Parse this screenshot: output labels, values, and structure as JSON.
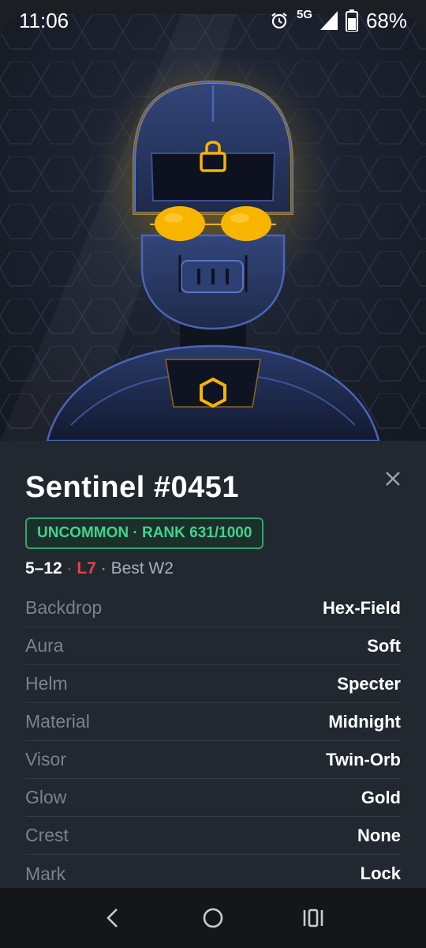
{
  "status": {
    "time": "11:06",
    "network": "5G",
    "battery": "68%"
  },
  "nft": {
    "title": "Sentinel #0451",
    "badge": "UNCOMMON · RANK 631/1000",
    "record": {
      "wins_losses": "5–12",
      "separator": " · ",
      "loss_streak": "L7",
      "best": "Best W2"
    },
    "traits": [
      {
        "label": "Backdrop",
        "value": "Hex-Field"
      },
      {
        "label": "Aura",
        "value": "Soft"
      },
      {
        "label": "Helm",
        "value": "Specter"
      },
      {
        "label": "Material",
        "value": "Midnight"
      },
      {
        "label": "Visor",
        "value": "Twin-Orb"
      },
      {
        "label": "Glow",
        "value": "Gold"
      },
      {
        "label": "Crest",
        "value": "None"
      },
      {
        "label": "Mark",
        "value": "Lock"
      }
    ]
  },
  "colors": {
    "accent_green": "#3fd48b",
    "loss_red": "#e84343",
    "glow_gold": "#f7b500",
    "armor_blue": "#3a4f8c"
  },
  "icons": {
    "close": "close-icon",
    "back": "back-icon",
    "home": "home-icon",
    "recents": "recents-icon"
  }
}
